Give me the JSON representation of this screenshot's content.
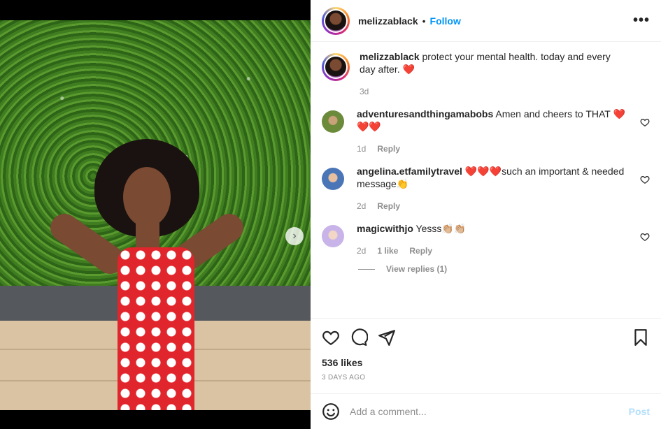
{
  "post": {
    "username": "melizzablack",
    "follow_label": "Follow",
    "separator": "•",
    "more_label": "•••",
    "carousel_next": "›"
  },
  "caption": {
    "username": "melizzablack",
    "text": "protect your mental health. today and every day after. ❤️",
    "time": "3d"
  },
  "comments": [
    {
      "username": "adventuresandthingamabobs",
      "text": "Amen and cheers to THAT ❤️❤️❤️",
      "time": "1d",
      "likes": "",
      "reply": "Reply"
    },
    {
      "username": "angelina.etfamilytravel",
      "text": "❤️❤️❤️such an important & needed message👏",
      "time": "2d",
      "likes": "",
      "reply": "Reply"
    },
    {
      "username": "magicwithjo",
      "text": "Yesss👏🏼👏🏼",
      "time": "2d",
      "likes": "1 like",
      "reply": "Reply"
    }
  ],
  "view_replies": "View replies (1)",
  "likes_count": "536 likes",
  "time_ago": "3 DAYS AGO",
  "add_comment": {
    "placeholder": "Add a comment...",
    "post_label": "Post"
  },
  "colors": {
    "accent": "#0095f6",
    "post_disabled": "#b2dffc",
    "muted": "#8e8e8e"
  },
  "icons": [
    "heart-icon",
    "comment-icon",
    "share-icon",
    "bookmark-icon",
    "emoji-icon",
    "more-icon",
    "chevron-right-icon"
  ]
}
